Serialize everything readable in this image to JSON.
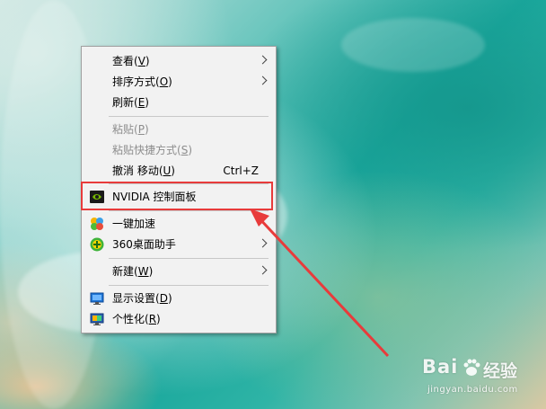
{
  "context_menu": {
    "items": [
      {
        "label": "查看(",
        "accel": "V",
        "tail": ")",
        "submenu": true,
        "disabled": false
      },
      {
        "label": "排序方式(",
        "accel": "O",
        "tail": ")",
        "submenu": true,
        "disabled": false
      },
      {
        "label": "刷新(",
        "accel": "E",
        "tail": ")",
        "submenu": false,
        "disabled": false
      },
      {
        "label": "粘贴(",
        "accel": "P",
        "tail": ")",
        "submenu": false,
        "disabled": true
      },
      {
        "label": "粘贴快捷方式(",
        "accel": "S",
        "tail": ")",
        "submenu": false,
        "disabled": true
      },
      {
        "label": "撤消 移动(",
        "accel": "U",
        "tail": ")",
        "shortcut": "Ctrl+Z",
        "submenu": false,
        "disabled": false
      },
      {
        "label": "NVIDIA 控制面板",
        "icon": "nvidia-icon",
        "submenu": false,
        "disabled": false
      },
      {
        "label": "一键加速",
        "icon": "speedup-icon",
        "submenu": false,
        "disabled": false
      },
      {
        "label": "360桌面助手",
        "icon": "360-assistant-icon",
        "submenu": true,
        "disabled": false
      },
      {
        "label": "新建(",
        "accel": "W",
        "tail": ")",
        "submenu": true,
        "disabled": false
      },
      {
        "label": "显示设置(",
        "accel": "D",
        "tail": ")",
        "icon": "display-icon",
        "submenu": false,
        "disabled": false
      },
      {
        "label": "个性化(",
        "accel": "R",
        "tail": ")",
        "icon": "personalize-icon",
        "submenu": false,
        "disabled": false
      }
    ]
  },
  "annotation": {
    "color": "#e83b3b"
  },
  "watermark": {
    "brand": "Bai",
    "brand2": "经验",
    "url": "jingyan.baidu.com"
  }
}
